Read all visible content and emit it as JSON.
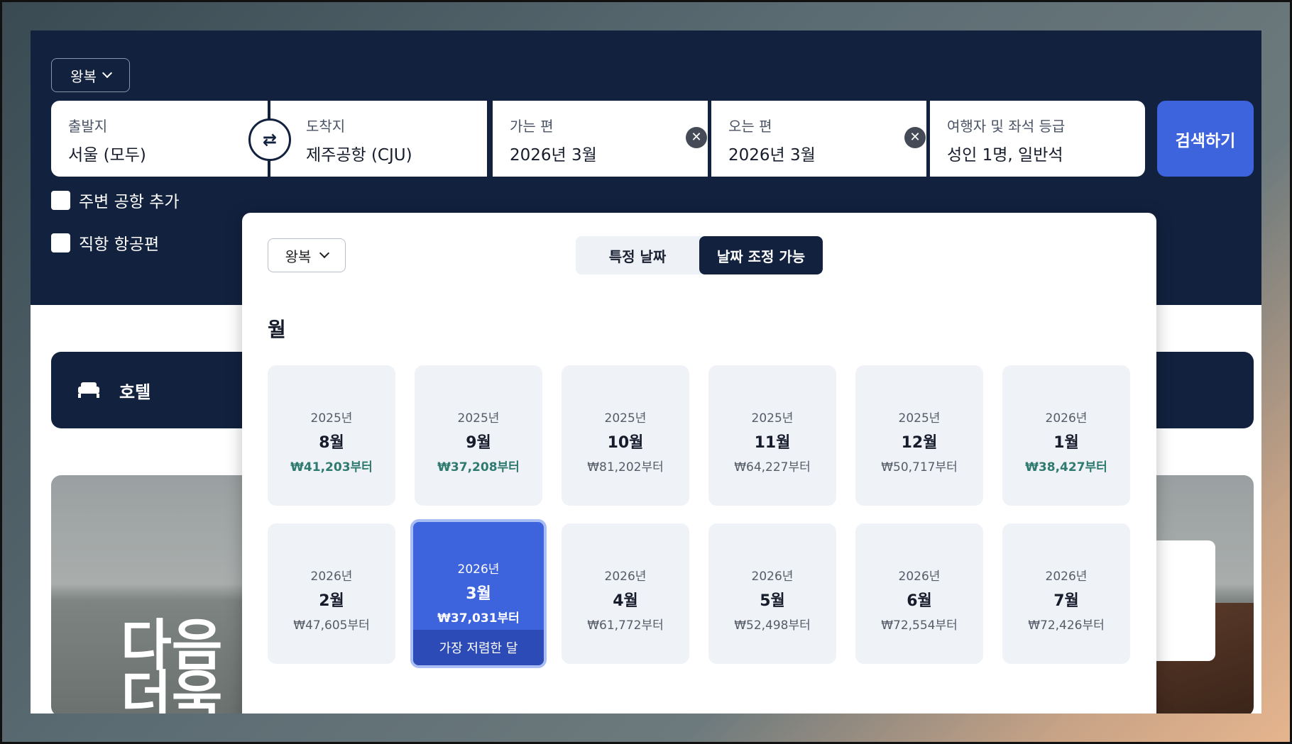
{
  "header": {
    "trip_type": "왕복",
    "origin": {
      "label": "출발지",
      "value": "서울 (모두)"
    },
    "destination": {
      "label": "도착지",
      "value": "제주공항 (CJU)"
    },
    "depart": {
      "label": "가는 편",
      "value": "2026년 3월"
    },
    "return": {
      "label": "오는 편",
      "value": "2026년 3월"
    },
    "travelers": {
      "label": "여행자 및 좌석 등급",
      "value": "성인 1명, 일반석"
    },
    "search_label": "검색하기",
    "nearby_label": "주변 공항 추가",
    "direct_label": "직항 항공편",
    "swap_glyph": "⇄",
    "clear_glyph": "✕"
  },
  "hotel_bar": {
    "label": "호텔",
    "icon": "bed-icon"
  },
  "promo": {
    "line1": "다음",
    "line2": "더욱"
  },
  "popup": {
    "trip_type": "왕복",
    "tabs": {
      "specific": "특정 날짜",
      "flexible": "날짜 조정 가능"
    },
    "month_title": "월",
    "cheapest_tag": "가장 저렴한 달",
    "months": [
      {
        "year": "2025년",
        "month": "8월",
        "price": "₩41,203부터",
        "cheap": true
      },
      {
        "year": "2025년",
        "month": "9월",
        "price": "₩37,208부터",
        "cheap": true
      },
      {
        "year": "2025년",
        "month": "10월",
        "price": "₩81,202부터",
        "cheap": false
      },
      {
        "year": "2025년",
        "month": "11월",
        "price": "₩64,227부터",
        "cheap": false
      },
      {
        "year": "2025년",
        "month": "12월",
        "price": "₩50,717부터",
        "cheap": false
      },
      {
        "year": "2026년",
        "month": "1월",
        "price": "₩38,427부터",
        "cheap": true
      },
      {
        "year": "2026년",
        "month": "2월",
        "price": "₩47,605부터",
        "cheap": false
      },
      {
        "year": "2026년",
        "month": "3월",
        "price": "₩37,031부터",
        "cheap": true,
        "selected": true
      },
      {
        "year": "2026년",
        "month": "4월",
        "price": "₩61,772부터",
        "cheap": false
      },
      {
        "year": "2026년",
        "month": "5월",
        "price": "₩52,498부터",
        "cheap": false
      },
      {
        "year": "2026년",
        "month": "6월",
        "price": "₩72,554부터",
        "cheap": false
      },
      {
        "year": "2026년",
        "month": "7월",
        "price": "₩72,426부터",
        "cheap": false
      }
    ]
  },
  "colors": {
    "navy": "#12213e",
    "accent": "#3d63dd",
    "cheap_price": "#2f7a6e"
  }
}
